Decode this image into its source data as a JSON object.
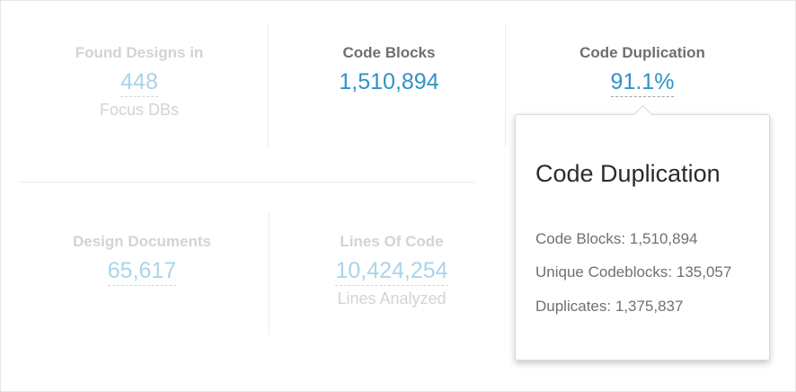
{
  "stats": {
    "found_designs": {
      "title": "Found Designs in",
      "value": "448",
      "sub": "Focus DBs"
    },
    "code_blocks": {
      "title": "Code Blocks",
      "value": "1,510,894"
    },
    "code_duplication": {
      "title": "Code Duplication",
      "value": "91.1%"
    },
    "design_documents": {
      "title": "Design Documents",
      "value": "65,617"
    },
    "lines_of_code": {
      "title": "Lines Of Code",
      "value": "10,424,254",
      "sub": "Lines Analyzed"
    }
  },
  "popover": {
    "title": "Code Duplication",
    "rows": [
      "Code Blocks: 1,510,894",
      "Unique Codeblocks: 135,057",
      "Duplicates: 1,375,837"
    ]
  },
  "colors": {
    "accent": "#2f93c7",
    "dim_value": "#a9d4ea",
    "dim_text": "#d3d3d3",
    "active_title": "#6f6f6f"
  }
}
